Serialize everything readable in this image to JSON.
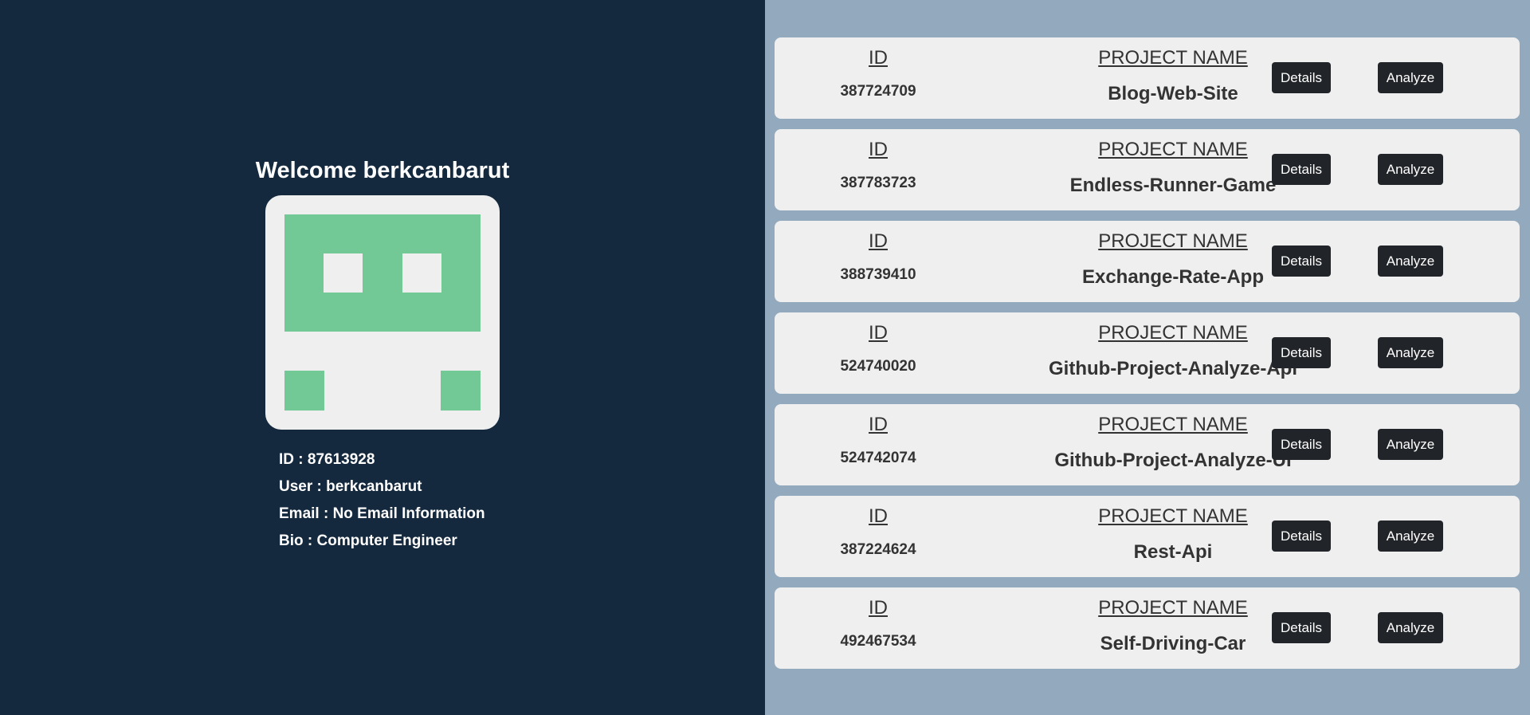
{
  "profile": {
    "welcome": "Welcome berkcanbarut",
    "avatar_colors": {
      "primary": "#72c996",
      "background": "#efefef"
    },
    "id_line": "ID : 87613928",
    "user_line": "User : berkcanbarut",
    "email_line": "Email : No Email Information",
    "bio_line": "Bio : Computer Engineer"
  },
  "projects": {
    "id_header": "ID",
    "name_header": "PROJECT NAME",
    "details_label": "Details",
    "analyze_label": "Analyze",
    "items": [
      {
        "id": "387724709",
        "name": "Blog-Web-Site"
      },
      {
        "id": "387783723",
        "name": "Endless-Runner-Game"
      },
      {
        "id": "388739410",
        "name": "Exchange-Rate-App"
      },
      {
        "id": "524740020",
        "name": "Github-Project-Analyze-Api"
      },
      {
        "id": "524742074",
        "name": "Github-Project-Analyze-UI"
      },
      {
        "id": "387224624",
        "name": "Rest-Api"
      },
      {
        "id": "492467534",
        "name": "Self-Driving-Car"
      }
    ]
  },
  "colors": {
    "left_bg": "#14293d",
    "right_bg": "#93a9bd",
    "card_bg": "#efefef",
    "button_bg": "#212529"
  }
}
